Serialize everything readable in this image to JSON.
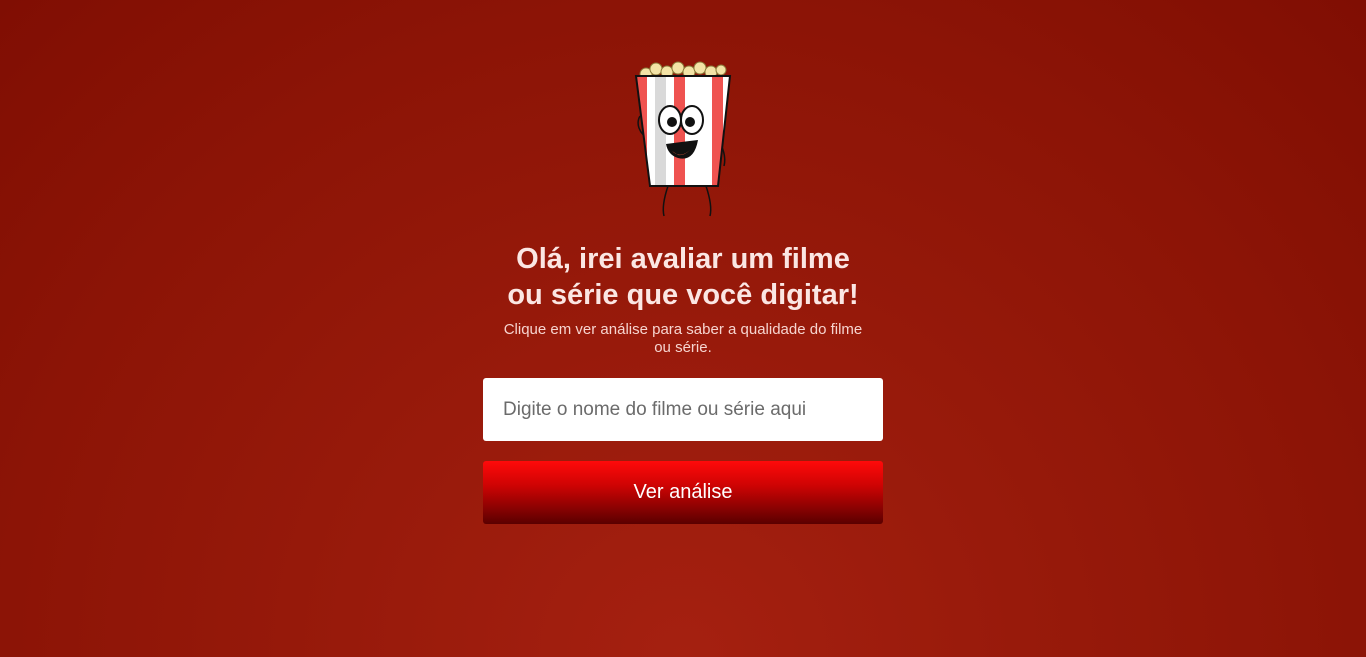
{
  "header": {
    "mascot_icon": "popcorn-mascot-icon",
    "title_line1": "Olá, irei avaliar um filme",
    "title_line2": "ou série que você digitar!",
    "subtitle_line1": "Clique em ver análise para saber a qualidade do filme",
    "subtitle_line2": "ou série."
  },
  "search": {
    "value": "",
    "placeholder": "Digite o nome do filme ou série aqui"
  },
  "actions": {
    "analyze_label": "Ver análise"
  },
  "colors": {
    "background": "#8c1406",
    "button_top": "#ff0a0a",
    "button_bottom": "#5a0000",
    "title_text": "#fbe6e3"
  }
}
